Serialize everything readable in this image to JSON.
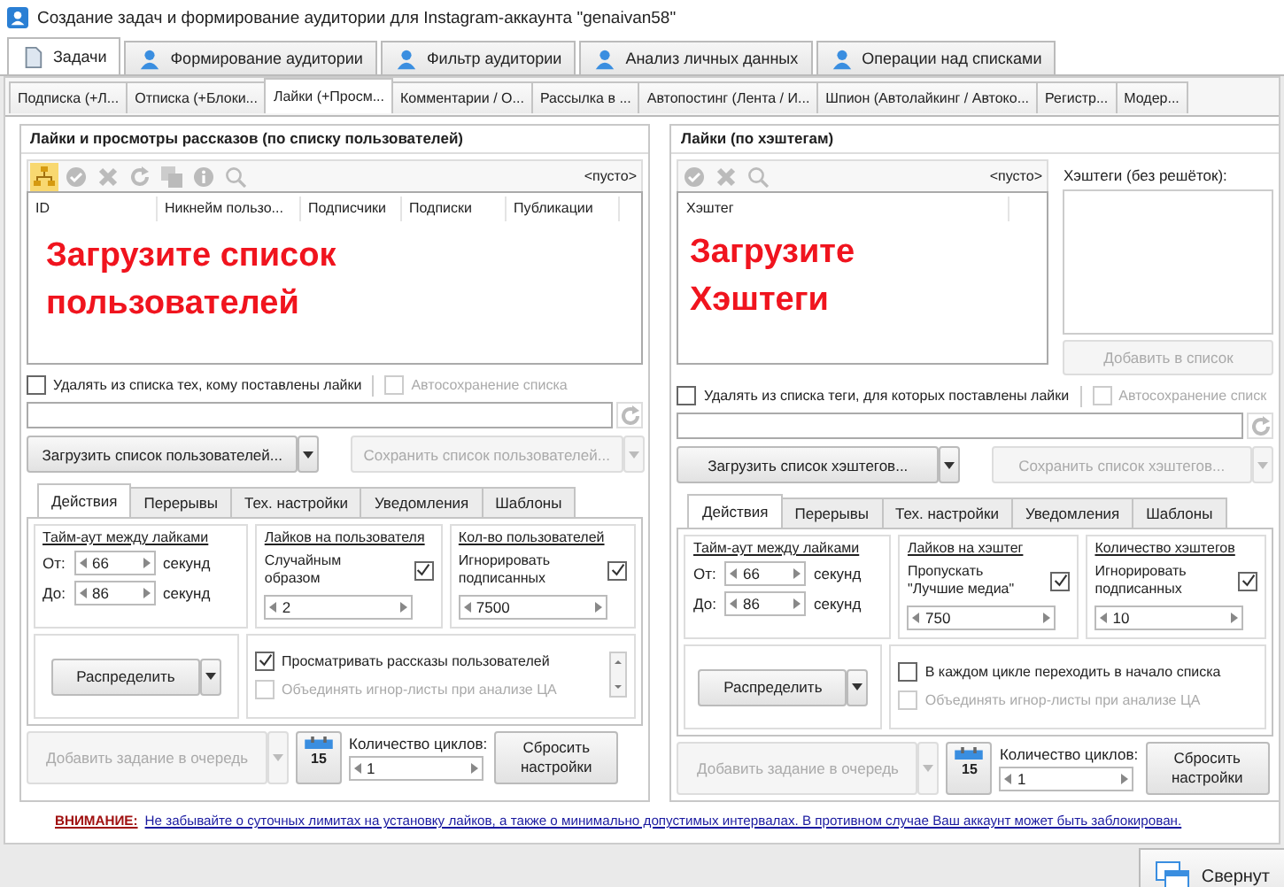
{
  "window": {
    "title": "Создание задач и формирование аудитории для Instagram-аккаунта \"genaivan58\""
  },
  "main_tabs": [
    {
      "label": "Задачи",
      "selected": true
    },
    {
      "label": "Формирование аудитории",
      "selected": false
    },
    {
      "label": "Фильтр аудитории",
      "selected": false
    },
    {
      "label": "Анализ личных данных",
      "selected": false
    },
    {
      "label": "Операции над списками",
      "selected": false
    }
  ],
  "sub_tabs": [
    {
      "label": "Подписка (+Л...",
      "selected": false
    },
    {
      "label": "Отписка (+Блоки...",
      "selected": false
    },
    {
      "label": "Лайки (+Просм...",
      "selected": true
    },
    {
      "label": "Комментарии / О...",
      "selected": false
    },
    {
      "label": "Рассылка в ...",
      "selected": false
    },
    {
      "label": "Автопостинг (Лента / И...",
      "selected": false
    },
    {
      "label": "Шпион (Автолайкинг / Автоко...",
      "selected": false
    },
    {
      "label": "Регистр...",
      "selected": false
    },
    {
      "label": "Модер...",
      "selected": false
    }
  ],
  "panels": [
    {
      "kind": "users",
      "title": "Лайки и просмотры рассказов (по списку пользователей)",
      "empty_label": "<пусто>",
      "columns": [
        "ID",
        "Никнейм пользо...",
        "Подписчики",
        "Подписки",
        "Публикации"
      ],
      "message": "Загрузите список пользователей",
      "remove_option": {
        "label": "Удалять из списка тех, кому поставлены лайки",
        "checked": false
      },
      "autosave": {
        "label": "Автосохранение списка",
        "checked": false,
        "disabled": true
      },
      "load_button": "Загрузить список пользователей...",
      "save_button": "Сохранить список пользователей...",
      "settings_tabs": [
        {
          "label": "Действия",
          "selected": true
        },
        {
          "label": "Перерывы",
          "selected": false
        },
        {
          "label": "Тех. настройки",
          "selected": false
        },
        {
          "label": "Уведомления",
          "selected": false
        },
        {
          "label": "Шаблоны",
          "selected": false
        }
      ],
      "timeout": {
        "title": "Тайм-аут между лайками",
        "from_label": "От:",
        "from_value": "66",
        "from_unit": "секунд",
        "to_label": "До:",
        "to_value": "86",
        "to_unit": "секунд"
      },
      "groups": [
        {
          "title": "Лайков на пользователя",
          "option": "Случайным образом",
          "checked": true,
          "value": "2"
        },
        {
          "title": "Кол-во пользователей",
          "option": "Игнорировать подписанных",
          "checked": true,
          "value": "7500"
        }
      ],
      "distribute_button": "Распределить",
      "options": [
        {
          "label": "Просматривать рассказы пользователей",
          "checked": true,
          "disabled": false
        },
        {
          "label": "Объединять игнор-листы при анализе ЦА",
          "checked": false,
          "disabled": true
        }
      ],
      "queue_button": "Добавить задание в очередь",
      "calendar_day": "15",
      "cycles_label": "Количество циклов:",
      "cycles_value": "1",
      "reset_button": "Сбросить настройки"
    },
    {
      "kind": "hashtags",
      "title": "Лайки (по хэштегам)",
      "empty_label": "<пусто>",
      "columns": [
        "Хэштег"
      ],
      "message": "Загрузите Хэштеги",
      "hashtag_label": "Хэштеги (без решёток):",
      "add_button": "Добавить в список",
      "remove_option": {
        "label": "Удалять из списка теги, для которых поставлены лайки",
        "checked": false
      },
      "autosave": {
        "label": "Автосохранение списк",
        "checked": false,
        "disabled": true
      },
      "load_button": "Загрузить список хэштегов...",
      "save_button": "Сохранить список хэштегов...",
      "settings_tabs": [
        {
          "label": "Действия",
          "selected": true
        },
        {
          "label": "Перерывы",
          "selected": false
        },
        {
          "label": "Тех. настройки",
          "selected": false
        },
        {
          "label": "Уведомления",
          "selected": false
        },
        {
          "label": "Шаблоны",
          "selected": false
        }
      ],
      "timeout": {
        "title": "Тайм-аут между лайками",
        "from_label": "От:",
        "from_value": "66",
        "from_unit": "секунд",
        "to_label": "До:",
        "to_value": "86",
        "to_unit": "секунд"
      },
      "groups": [
        {
          "title": "Лайков на хэштег",
          "option": "Пропускать \"Лучшие медиа\"",
          "checked": true,
          "value": "750"
        },
        {
          "title": "Количество хэштегов",
          "option": "Игнорировать подписанных",
          "checked": true,
          "value": "10"
        }
      ],
      "distribute_button": "Распределить",
      "options": [
        {
          "label": "В каждом цикле переходить в начало списка",
          "checked": false,
          "disabled": false
        },
        {
          "label": "Объединять игнор-листы при анализе ЦА",
          "checked": false,
          "disabled": true
        }
      ],
      "queue_button": "Добавить задание в очередь",
      "calendar_day": "15",
      "cycles_label": "Количество циклов:",
      "cycles_value": "1",
      "reset_button": "Сбросить настройки"
    }
  ],
  "notice": {
    "label": "ВНИМАНИЕ:",
    "link": "Не забывайте о суточных лимитах на установку лайков, а также о минимально допустимых интервалах. В противном случае Ваш аккаунт может быть заблокирован."
  },
  "minimize_button": "Свернут"
}
